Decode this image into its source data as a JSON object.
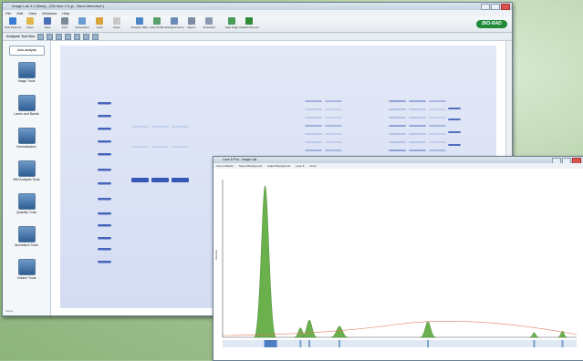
{
  "main_window": {
    "title": "Image Lab 4.0 (Beta) - [SN blue 2 5 gr - Band detection*]",
    "menu": [
      "File",
      "Edit",
      "View",
      "Windows",
      "Help"
    ],
    "toolbar": [
      {
        "label": "New Protocol",
        "icon": "new-protocol-icon",
        "color": "#3a7bd5"
      },
      {
        "label": "Open",
        "icon": "open-icon",
        "color": "#e0b84a"
      },
      {
        "label": "Save",
        "icon": "save-icon",
        "color": "#4a6fb5"
      },
      {
        "label": "Print",
        "icon": "print-icon",
        "color": "#7a8a99"
      },
      {
        "label": "Screenshot",
        "icon": "screenshot-icon",
        "color": "#6b9bd1"
      },
      {
        "label": "Undo",
        "icon": "undo-icon",
        "color": "#d8a23a"
      },
      {
        "label": "Redo",
        "icon": "redo-icon",
        "color": "#c8c8c8"
      },
      {
        "label": "Analysis Table",
        "icon": "analysis-table-icon",
        "color": "#4a86c5"
      },
      {
        "label": "Lane Profile",
        "icon": "lane-profile-icon",
        "color": "#5aa06a"
      },
      {
        "label": "Standard Curve",
        "icon": "standard-curve-icon",
        "color": "#6a8ab5"
      },
      {
        "label": "Report",
        "icon": "report-icon",
        "color": "#7a8aa5"
      },
      {
        "label": "Threshold",
        "icon": "threshold-icon",
        "color": "#8a9ab5"
      },
      {
        "label": "Start Page",
        "icon": "start-page-icon",
        "color": "#4a9a5a"
      },
      {
        "label": "Default Protocol",
        "icon": "default-protocol-icon",
        "color": "#2e8b3a"
      }
    ],
    "logo": "BIO-RAD",
    "subbar_label": "Analysis Tool Box",
    "auto_analysis": "Auto-analysis",
    "side_tools": [
      "Image Tools",
      "Lanes and Bands",
      "Normalization",
      "MW Analysis Tools",
      "Quantity Tools",
      "Annotation Tools",
      "Volume Tools"
    ],
    "sidebar_footer": "Lanes"
  },
  "plot_window": {
    "title": "Lane 8 Plot - Image Lab",
    "toolbar": [
      "Lane & Bands",
      "Select Background",
      "Adjust Background",
      "Lane 8",
      "Zoom"
    ]
  },
  "colors": {
    "gel_band": "#2d4fb0",
    "peak_fill": "#6ab04c",
    "baseline": "#e07a5f",
    "brand_green": "#1f8a3a"
  },
  "chart_data": {
    "type": "area",
    "xlabel": "",
    "ylabel": "Intensity",
    "peaks": [
      {
        "x": 0.12,
        "height": 0.96,
        "width": 0.014
      },
      {
        "x": 0.22,
        "height": 0.06,
        "width": 0.008
      },
      {
        "x": 0.245,
        "height": 0.11,
        "width": 0.01
      },
      {
        "x": 0.33,
        "height": 0.07,
        "width": 0.011
      },
      {
        "x": 0.58,
        "height": 0.1,
        "width": 0.01
      },
      {
        "x": 0.88,
        "height": 0.03,
        "width": 0.006
      },
      {
        "x": 0.96,
        "height": 0.04,
        "width": 0.006
      }
    ]
  }
}
